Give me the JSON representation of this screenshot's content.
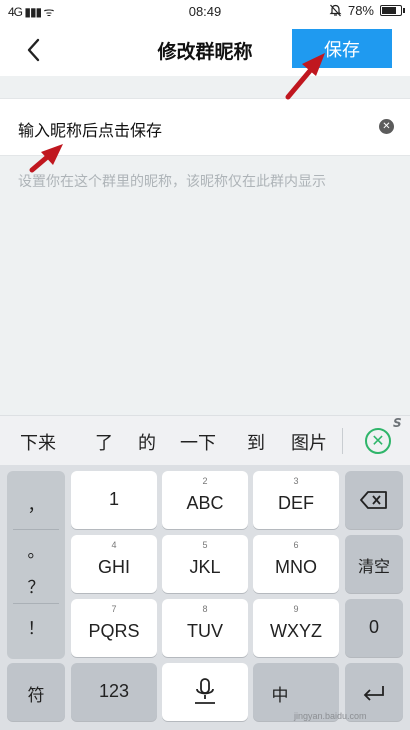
{
  "status_bar": {
    "signal": "4G ▮▮▮ ᯤ",
    "time": "08:49",
    "mute_icon": "bell-off-icon",
    "battery": "78%",
    "battery_level": 0.78
  },
  "nav": {
    "title": "修改群昵称",
    "save_label": "保存"
  },
  "input": {
    "value": "输入昵称后点击保存",
    "clear_glyph": "✕"
  },
  "hint": "设置你在这个群里的昵称，该昵称仅在此群内显示",
  "candidates": [
    "下来",
    "了",
    "的",
    "一下",
    "到",
    "图片"
  ],
  "candidate_more": "✕",
  "candidate_mark": "S",
  "keyboard": {
    "punct": [
      "，",
      "。",
      "？",
      "！"
    ],
    "keys": [
      {
        "num": "",
        "label": "1"
      },
      {
        "num": "2",
        "label": "ABC"
      },
      {
        "num": "3",
        "label": "DEF"
      },
      {
        "num": "4",
        "label": "GHI"
      },
      {
        "num": "5",
        "label": "JKL"
      },
      {
        "num": "6",
        "label": "MNO"
      },
      {
        "num": "7",
        "label": "PQRS"
      },
      {
        "num": "8",
        "label": "TUV"
      },
      {
        "num": "9",
        "label": "WXYZ"
      }
    ],
    "backspace_icon": "backspace-icon",
    "clear_label": "清空",
    "zero_label": "0",
    "symbol_label": "符",
    "num_label": "123",
    "mic_icon": "microphone-icon",
    "lang_label": "中",
    "enter_icon": "enter-icon"
  },
  "watermark": "jingyan.baidu.com",
  "annotation_color": "#c0171f"
}
